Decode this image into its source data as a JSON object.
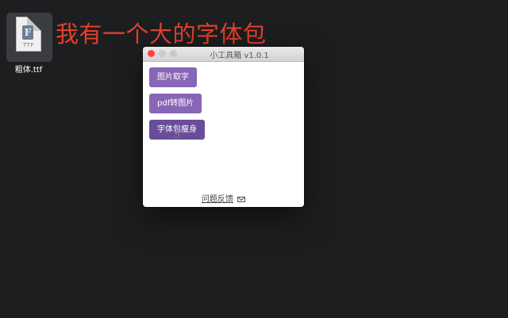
{
  "desktop": {
    "file": {
      "name": "粗体.ttf",
      "badge": "TTF",
      "glyph": "F",
      "icon": "ttf-font-file-icon"
    },
    "headline": "我有一个大的字体包",
    "headline_color": "#e2402c",
    "background_color": "#1d1e20"
  },
  "window": {
    "title": "小工具箱 v1.0.1",
    "buttons": [
      {
        "label": "图片取字"
      },
      {
        "label": "pdf转图片"
      },
      {
        "label": "字体包瘦身"
      }
    ],
    "button_color": "#8765b7",
    "feedback_label": "问题反馈",
    "feedback_icon": "mail-icon",
    "cursor_icon": "hand-pointer-icon"
  }
}
